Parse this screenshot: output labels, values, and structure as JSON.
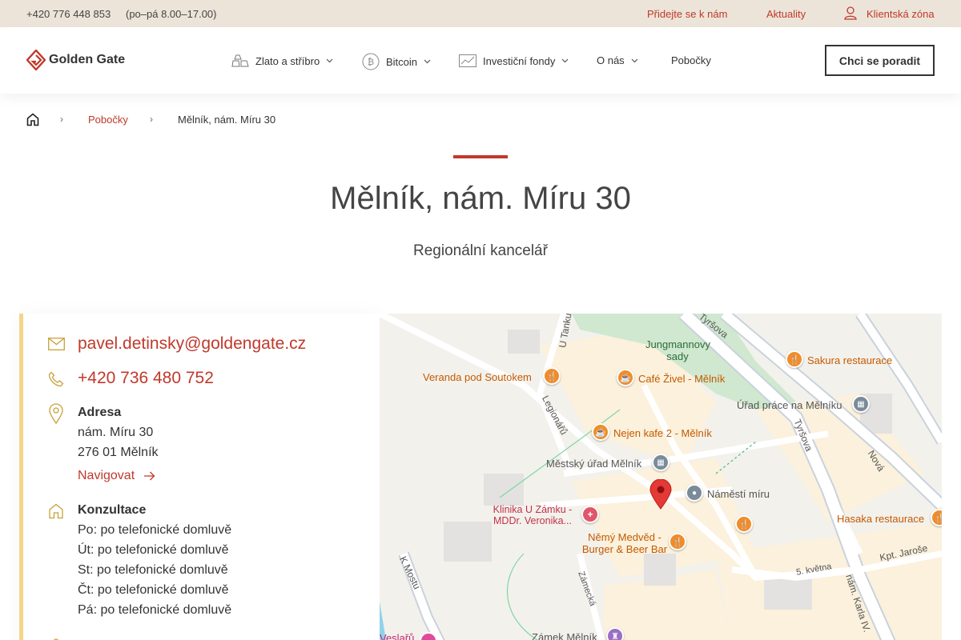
{
  "topbar": {
    "phone": "+420 776 448 853",
    "hours": "(po–pá 8.00–17.00)",
    "links": [
      "Přidejte se k nám",
      "Aktuality",
      "Klientská zóna"
    ]
  },
  "header": {
    "logo_text": "Golden Gate",
    "nav": [
      {
        "label": "Zlato a stříbro",
        "icon": "gold-bars-icon"
      },
      {
        "label": "Bitcoin",
        "icon": "bitcoin-icon"
      },
      {
        "label": "Investiční fondy",
        "icon": "chart-icon"
      },
      {
        "label": "O nás",
        "icon": ""
      },
      {
        "label": "Pobočky",
        "icon": ""
      }
    ],
    "cta_label": "Chci se poradit"
  },
  "breadcrumb": {
    "items": [
      "Pobočky",
      "Mělník, nám. Míru 30"
    ]
  },
  "page": {
    "title": "Mělník, nám. Míru 30",
    "subtitle": "Regionální kancelář"
  },
  "contact": {
    "email": "pavel.detinsky@goldengate.cz",
    "phone": "+420 736 480 752",
    "address_label": "Adresa",
    "address_line1": "nám. Míru 30",
    "address_line2": "276 01 Mělník",
    "navigate_label": "Navigovat",
    "consult_label": "Konzultace",
    "consult_hours": [
      "Po: po telefonické domluvě",
      "Út: po telefonické domluvě",
      "St: po telefonické domluvě",
      "Čt: po telefonické domluvě",
      "Pá: po telefonické domluvě"
    ]
  },
  "map": {
    "places": [
      "Veranda pod Soutokem",
      "Café Živel - Mělník",
      "Sakura restaurace",
      "Jungmannovy sady",
      "Úřad práce na Mělníku",
      "Nejen kafe 2 - Mělník",
      "Městský úřad Mělník",
      "Náměstí míru",
      "Klinika U Zámku - MDDr. Veronika...",
      "Němý Medvěd - Burger & Beer Bar",
      "Hasaka restaurace",
      "Zámek Mělník",
      "Veslařů"
    ],
    "streets": [
      "Tyršova",
      "U Tanku",
      "Legionářů",
      "Nová",
      "K Mostu",
      "Zámecká",
      "Kpt. Jaroše",
      "5. května",
      "nám. Karla IV."
    ]
  },
  "colors": {
    "accent": "#c0392b",
    "topbar_bg": "#ece4d9",
    "panel_border": "#f5d58a"
  }
}
